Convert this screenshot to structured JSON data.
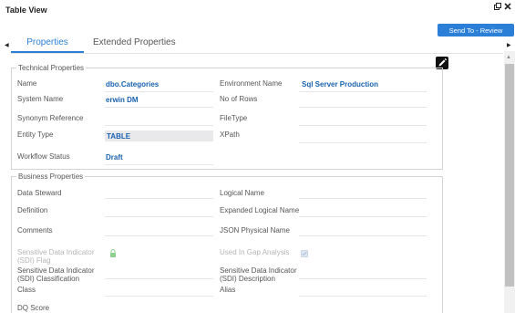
{
  "window": {
    "title": "Table View",
    "restore_icon": "restore-icon",
    "close_icon": "close-icon"
  },
  "send_button": "Send To - Review",
  "tabs": [
    {
      "label": "Properties",
      "active": true
    },
    {
      "label": "Extended Properties",
      "active": false
    }
  ],
  "technical": {
    "legend": "Technical Properties",
    "left": [
      {
        "label": "Name",
        "value": "dbo.Categories"
      },
      {
        "label": "System Name",
        "value": "erwin DM"
      },
      {
        "label": "Synonym Reference",
        "value": ""
      },
      {
        "label": "Entity Type",
        "value": "TABLE"
      },
      {
        "label": "Workflow Status",
        "value": "Draft"
      }
    ],
    "right": [
      {
        "label": "Environment Name",
        "value": "Sql Server Production"
      },
      {
        "label": "No of Rows",
        "value": ""
      },
      {
        "label": "FileType",
        "value": ""
      },
      {
        "label": "XPath",
        "value": ""
      }
    ]
  },
  "business": {
    "legend": "Business Properties",
    "left": [
      {
        "label": "Data Steward"
      },
      {
        "label": "Definition"
      },
      {
        "label": "Comments"
      },
      {
        "label": "Sensitive Data Indicator (SDI) Flag"
      },
      {
        "label": "Sensitive Data Indicator (SDI) Classification"
      },
      {
        "label": "Class"
      },
      {
        "label": "DQ Score"
      }
    ],
    "right": [
      {
        "label": "Logical Name"
      },
      {
        "label": "Expanded Logical Name"
      },
      {
        "label": "JSON Physical Name"
      },
      {
        "label": "Used In Gap Analysis"
      },
      {
        "label": "Sensitive Data Indicator (SDI) Description"
      },
      {
        "label": "Alias"
      }
    ]
  },
  "colors": {
    "accent": "#2b7fd6",
    "value_text": "#1a62b0",
    "dim_label": "#b5b5b5"
  }
}
